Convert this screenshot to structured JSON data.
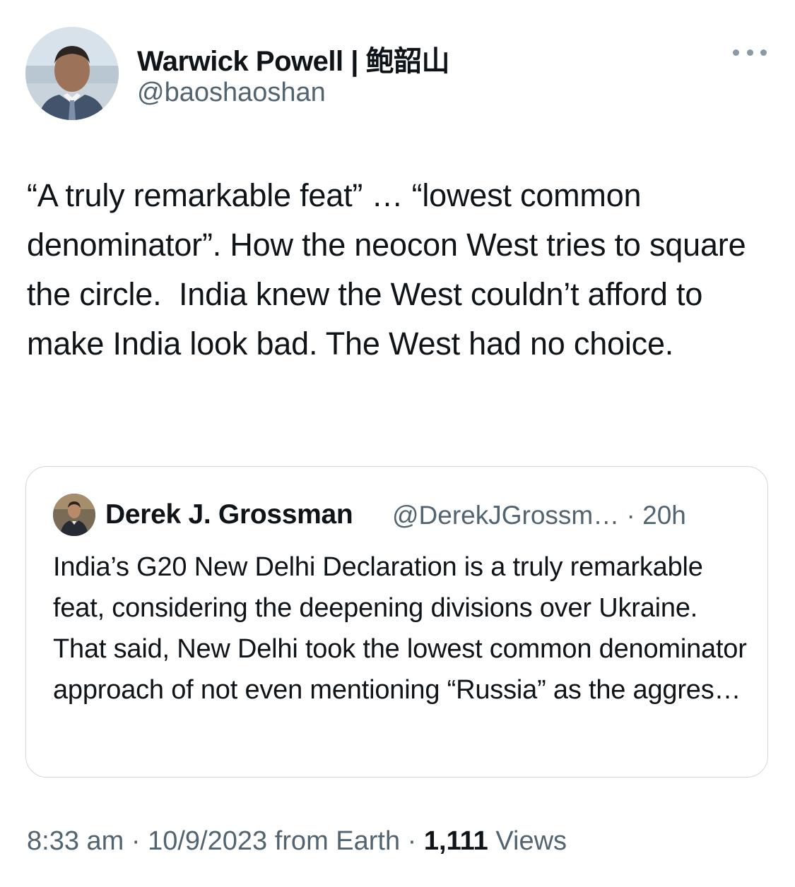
{
  "author": {
    "name": "Warwick Powell | 鲍韶山",
    "handle": "@baoshaoshan"
  },
  "tweet": {
    "text": "“A truly remarkable feat” … “lowest common denominator”. How the neocon West tries to square the circle.  India knew the West couldn’t afford to make India look bad. The West had no choice."
  },
  "quoted_tweet": {
    "author_name": "Derek J. Grossman",
    "author_handle": "@DerekJGrossm…",
    "separator": "·",
    "time": "20h",
    "text": "India’s G20 New Delhi Declaration is a truly remarkable feat, considering the deepening divisions over Ukraine. That said, New Delhi took the lowest common denominator approach of not even mentioning “Russia” as the aggres…"
  },
  "footer": {
    "time": "8:33 am",
    "separator1": "·",
    "date": "10/9/2023",
    "source": "from Earth",
    "separator2": "·",
    "views_count": "1,111",
    "views_label": "Views"
  },
  "icons": {
    "more": "more-horizontal-icon"
  },
  "colors": {
    "text_primary": "#0f1419",
    "text_secondary": "#536471",
    "border": "#cfd9de"
  }
}
